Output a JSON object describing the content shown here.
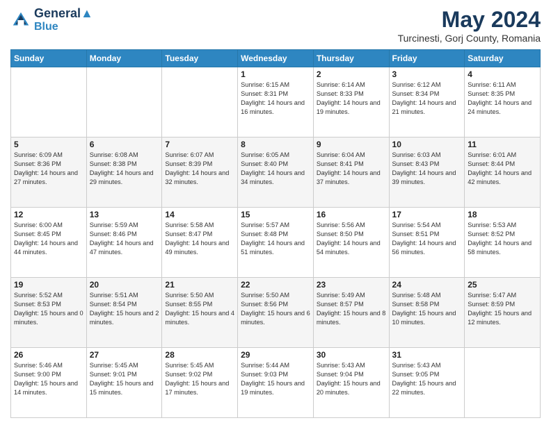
{
  "header": {
    "logo_line1": "General",
    "logo_line2": "Blue",
    "month_year": "May 2024",
    "location": "Turcinesti, Gorj County, Romania"
  },
  "days_of_week": [
    "Sunday",
    "Monday",
    "Tuesday",
    "Wednesday",
    "Thursday",
    "Friday",
    "Saturday"
  ],
  "weeks": [
    [
      {
        "day": "",
        "content": ""
      },
      {
        "day": "",
        "content": ""
      },
      {
        "day": "",
        "content": ""
      },
      {
        "day": "1",
        "content": "Sunrise: 6:15 AM\nSunset: 8:31 PM\nDaylight: 14 hours\nand 16 minutes."
      },
      {
        "day": "2",
        "content": "Sunrise: 6:14 AM\nSunset: 8:33 PM\nDaylight: 14 hours\nand 19 minutes."
      },
      {
        "day": "3",
        "content": "Sunrise: 6:12 AM\nSunset: 8:34 PM\nDaylight: 14 hours\nand 21 minutes."
      },
      {
        "day": "4",
        "content": "Sunrise: 6:11 AM\nSunset: 8:35 PM\nDaylight: 14 hours\nand 24 minutes."
      }
    ],
    [
      {
        "day": "5",
        "content": "Sunrise: 6:09 AM\nSunset: 8:36 PM\nDaylight: 14 hours\nand 27 minutes."
      },
      {
        "day": "6",
        "content": "Sunrise: 6:08 AM\nSunset: 8:38 PM\nDaylight: 14 hours\nand 29 minutes."
      },
      {
        "day": "7",
        "content": "Sunrise: 6:07 AM\nSunset: 8:39 PM\nDaylight: 14 hours\nand 32 minutes."
      },
      {
        "day": "8",
        "content": "Sunrise: 6:05 AM\nSunset: 8:40 PM\nDaylight: 14 hours\nand 34 minutes."
      },
      {
        "day": "9",
        "content": "Sunrise: 6:04 AM\nSunset: 8:41 PM\nDaylight: 14 hours\nand 37 minutes."
      },
      {
        "day": "10",
        "content": "Sunrise: 6:03 AM\nSunset: 8:43 PM\nDaylight: 14 hours\nand 39 minutes."
      },
      {
        "day": "11",
        "content": "Sunrise: 6:01 AM\nSunset: 8:44 PM\nDaylight: 14 hours\nand 42 minutes."
      }
    ],
    [
      {
        "day": "12",
        "content": "Sunrise: 6:00 AM\nSunset: 8:45 PM\nDaylight: 14 hours\nand 44 minutes."
      },
      {
        "day": "13",
        "content": "Sunrise: 5:59 AM\nSunset: 8:46 PM\nDaylight: 14 hours\nand 47 minutes."
      },
      {
        "day": "14",
        "content": "Sunrise: 5:58 AM\nSunset: 8:47 PM\nDaylight: 14 hours\nand 49 minutes."
      },
      {
        "day": "15",
        "content": "Sunrise: 5:57 AM\nSunset: 8:48 PM\nDaylight: 14 hours\nand 51 minutes."
      },
      {
        "day": "16",
        "content": "Sunrise: 5:56 AM\nSunset: 8:50 PM\nDaylight: 14 hours\nand 54 minutes."
      },
      {
        "day": "17",
        "content": "Sunrise: 5:54 AM\nSunset: 8:51 PM\nDaylight: 14 hours\nand 56 minutes."
      },
      {
        "day": "18",
        "content": "Sunrise: 5:53 AM\nSunset: 8:52 PM\nDaylight: 14 hours\nand 58 minutes."
      }
    ],
    [
      {
        "day": "19",
        "content": "Sunrise: 5:52 AM\nSunset: 8:53 PM\nDaylight: 15 hours\nand 0 minutes."
      },
      {
        "day": "20",
        "content": "Sunrise: 5:51 AM\nSunset: 8:54 PM\nDaylight: 15 hours\nand 2 minutes."
      },
      {
        "day": "21",
        "content": "Sunrise: 5:50 AM\nSunset: 8:55 PM\nDaylight: 15 hours\nand 4 minutes."
      },
      {
        "day": "22",
        "content": "Sunrise: 5:50 AM\nSunset: 8:56 PM\nDaylight: 15 hours\nand 6 minutes."
      },
      {
        "day": "23",
        "content": "Sunrise: 5:49 AM\nSunset: 8:57 PM\nDaylight: 15 hours\nand 8 minutes."
      },
      {
        "day": "24",
        "content": "Sunrise: 5:48 AM\nSunset: 8:58 PM\nDaylight: 15 hours\nand 10 minutes."
      },
      {
        "day": "25",
        "content": "Sunrise: 5:47 AM\nSunset: 8:59 PM\nDaylight: 15 hours\nand 12 minutes."
      }
    ],
    [
      {
        "day": "26",
        "content": "Sunrise: 5:46 AM\nSunset: 9:00 PM\nDaylight: 15 hours\nand 14 minutes."
      },
      {
        "day": "27",
        "content": "Sunrise: 5:45 AM\nSunset: 9:01 PM\nDaylight: 15 hours\nand 15 minutes."
      },
      {
        "day": "28",
        "content": "Sunrise: 5:45 AM\nSunset: 9:02 PM\nDaylight: 15 hours\nand 17 minutes."
      },
      {
        "day": "29",
        "content": "Sunrise: 5:44 AM\nSunset: 9:03 PM\nDaylight: 15 hours\nand 19 minutes."
      },
      {
        "day": "30",
        "content": "Sunrise: 5:43 AM\nSunset: 9:04 PM\nDaylight: 15 hours\nand 20 minutes."
      },
      {
        "day": "31",
        "content": "Sunrise: 5:43 AM\nSunset: 9:05 PM\nDaylight: 15 hours\nand 22 minutes."
      },
      {
        "day": "",
        "content": ""
      }
    ]
  ]
}
